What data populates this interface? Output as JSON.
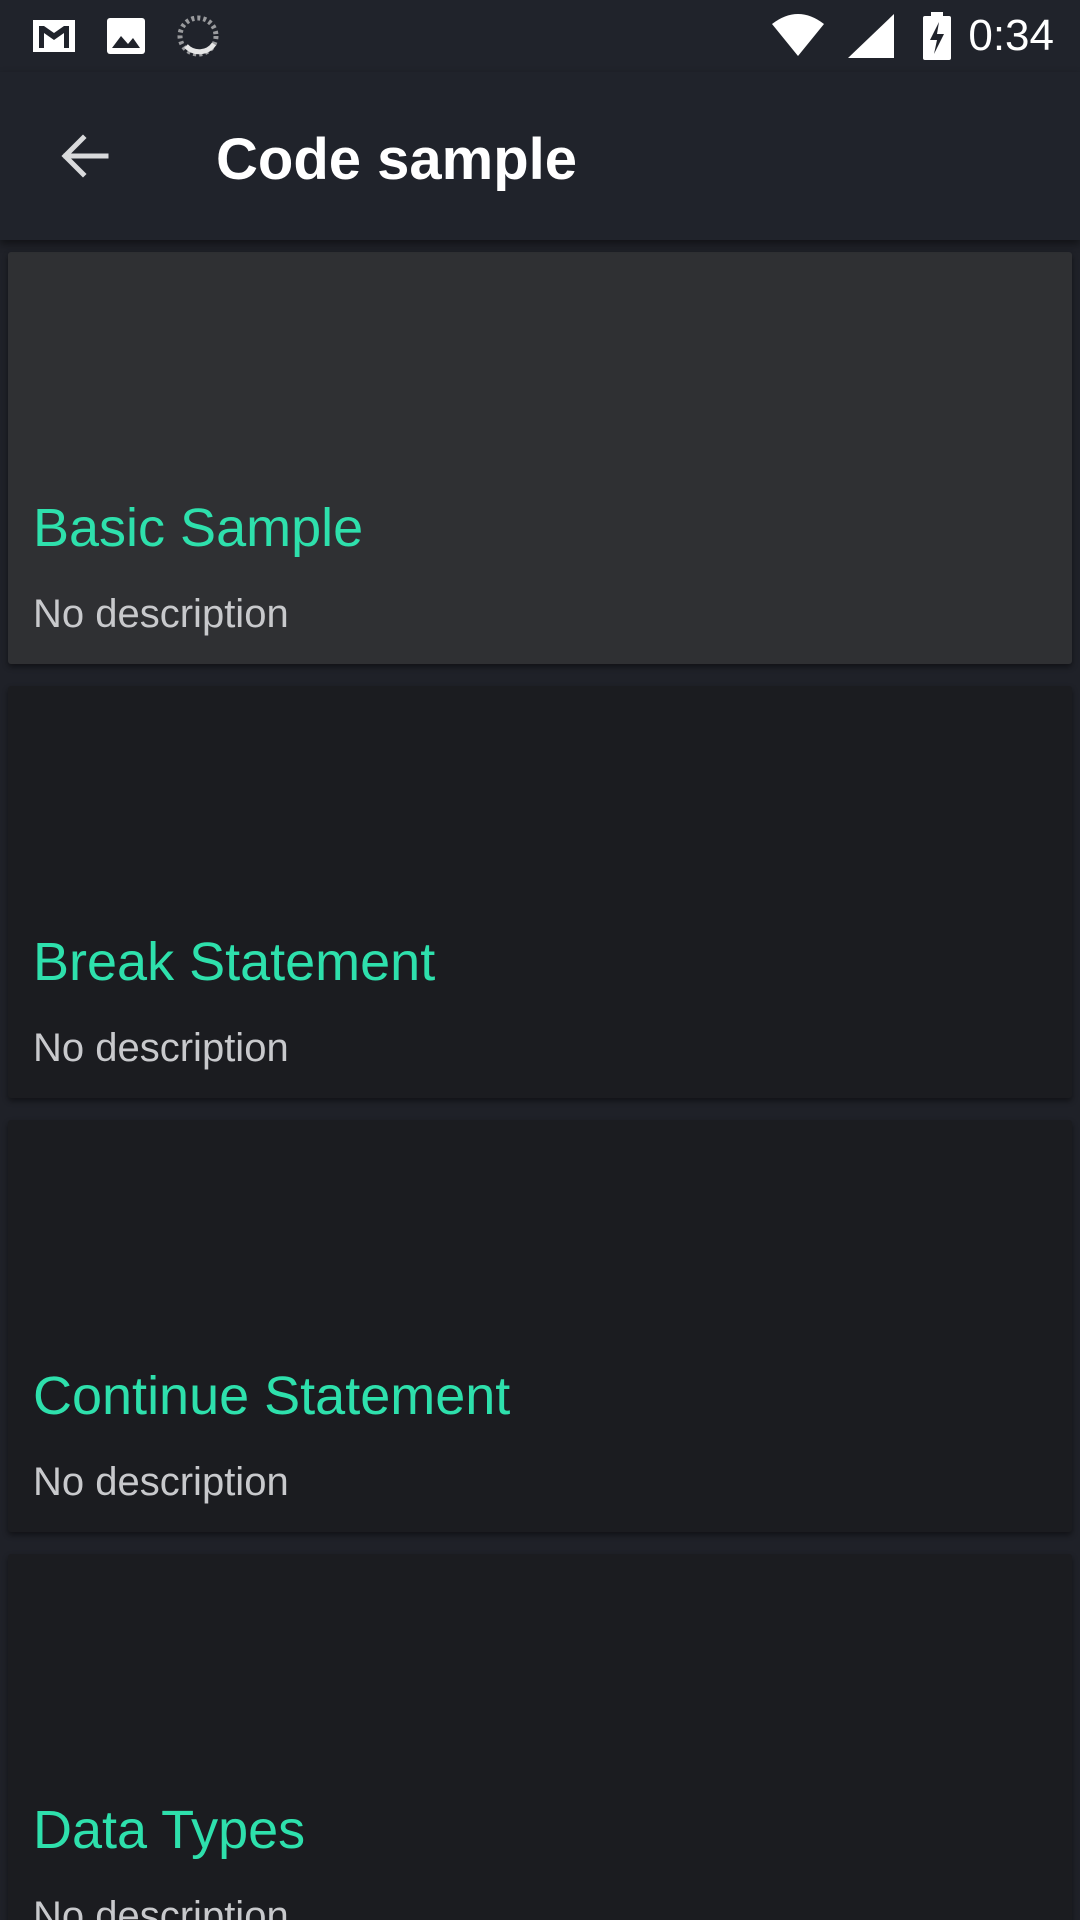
{
  "status_bar": {
    "time": "0:34",
    "notification_icons": [
      "gmail-icon",
      "image-icon",
      "sync-icon"
    ],
    "system_icons": [
      "wifi-icon",
      "cellular-signal-icon",
      "battery-charging-icon"
    ]
  },
  "app_bar": {
    "title": "Code sample",
    "back_icon": "arrow-back-icon"
  },
  "samples": [
    {
      "title": "Basic Sample",
      "description": "No description"
    },
    {
      "title": "Break Statement",
      "description": "No description"
    },
    {
      "title": "Continue Statement",
      "description": "No description"
    },
    {
      "title": "Data Types",
      "description": "No description"
    }
  ],
  "colors": {
    "background": "#1f2128",
    "card": "#1b1c20",
    "card_selected": "#2f3033",
    "accent_title": "#2ee0ac",
    "description_text": "#c8c9cc"
  }
}
